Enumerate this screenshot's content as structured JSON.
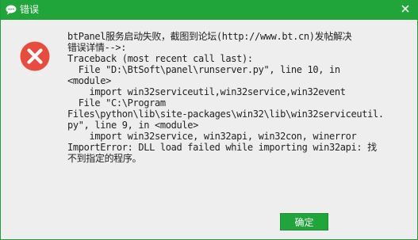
{
  "dialog": {
    "title": "错误",
    "message": "btPanel服务启动失败，截图到论坛(http://www.bt.cn)发帖解决\n错误详情-->:\nTraceback (most recent call last):\n  File \"D:\\BtSoft\\panel\\runserver.py\", line 10, in\n<module>\n    import win32serviceutil,win32service,win32event\n  File \"C:\\Program\nFiles\\python\\lib\\site-packages\\win32\\lib\\win32serviceutil.\npy\", line 9, in <module>\n    import win32service, win32api, win32con, winerror\nImportError: DLL load failed while importing win32api: 找\n不到指定的程序。",
    "ok_label": "确定"
  },
  "icons": {
    "title": "chat-bubble-icon",
    "close": "close-icon",
    "error": "error-icon"
  },
  "colors": {
    "accent": "#20a53a",
    "error": "#e84c3d",
    "background": "#eeeeee"
  }
}
